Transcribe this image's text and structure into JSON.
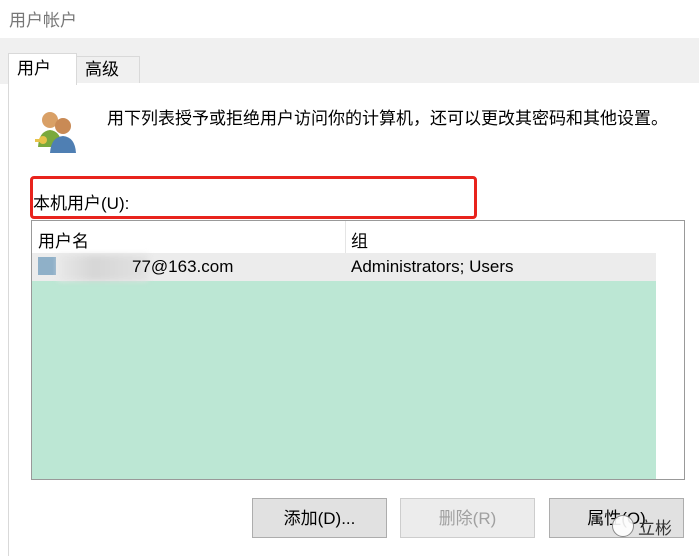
{
  "window": {
    "title": "用户帐户"
  },
  "tabs": [
    {
      "label": "用户",
      "selected": true
    },
    {
      "label": "高级",
      "selected": false
    }
  ],
  "description": "用下列表授予或拒绝用户访问你的计算机，还可以更改其密码和其他设置。",
  "local_users_label": "本机用户(U):",
  "list": {
    "columns": [
      "用户名",
      "组"
    ],
    "rows": [
      {
        "username_visible": "77@163.com",
        "group": "Administrators; Users"
      }
    ]
  },
  "buttons": {
    "add": "添加(D)...",
    "remove": "删除(R)",
    "properties": "属性(O)"
  },
  "watermark": "立彬",
  "colors": {
    "list_background": "#bce7d4",
    "highlight_border": "#e8231d"
  },
  "icons": {
    "users": "users-icon",
    "wechat": "wechat-icon"
  }
}
